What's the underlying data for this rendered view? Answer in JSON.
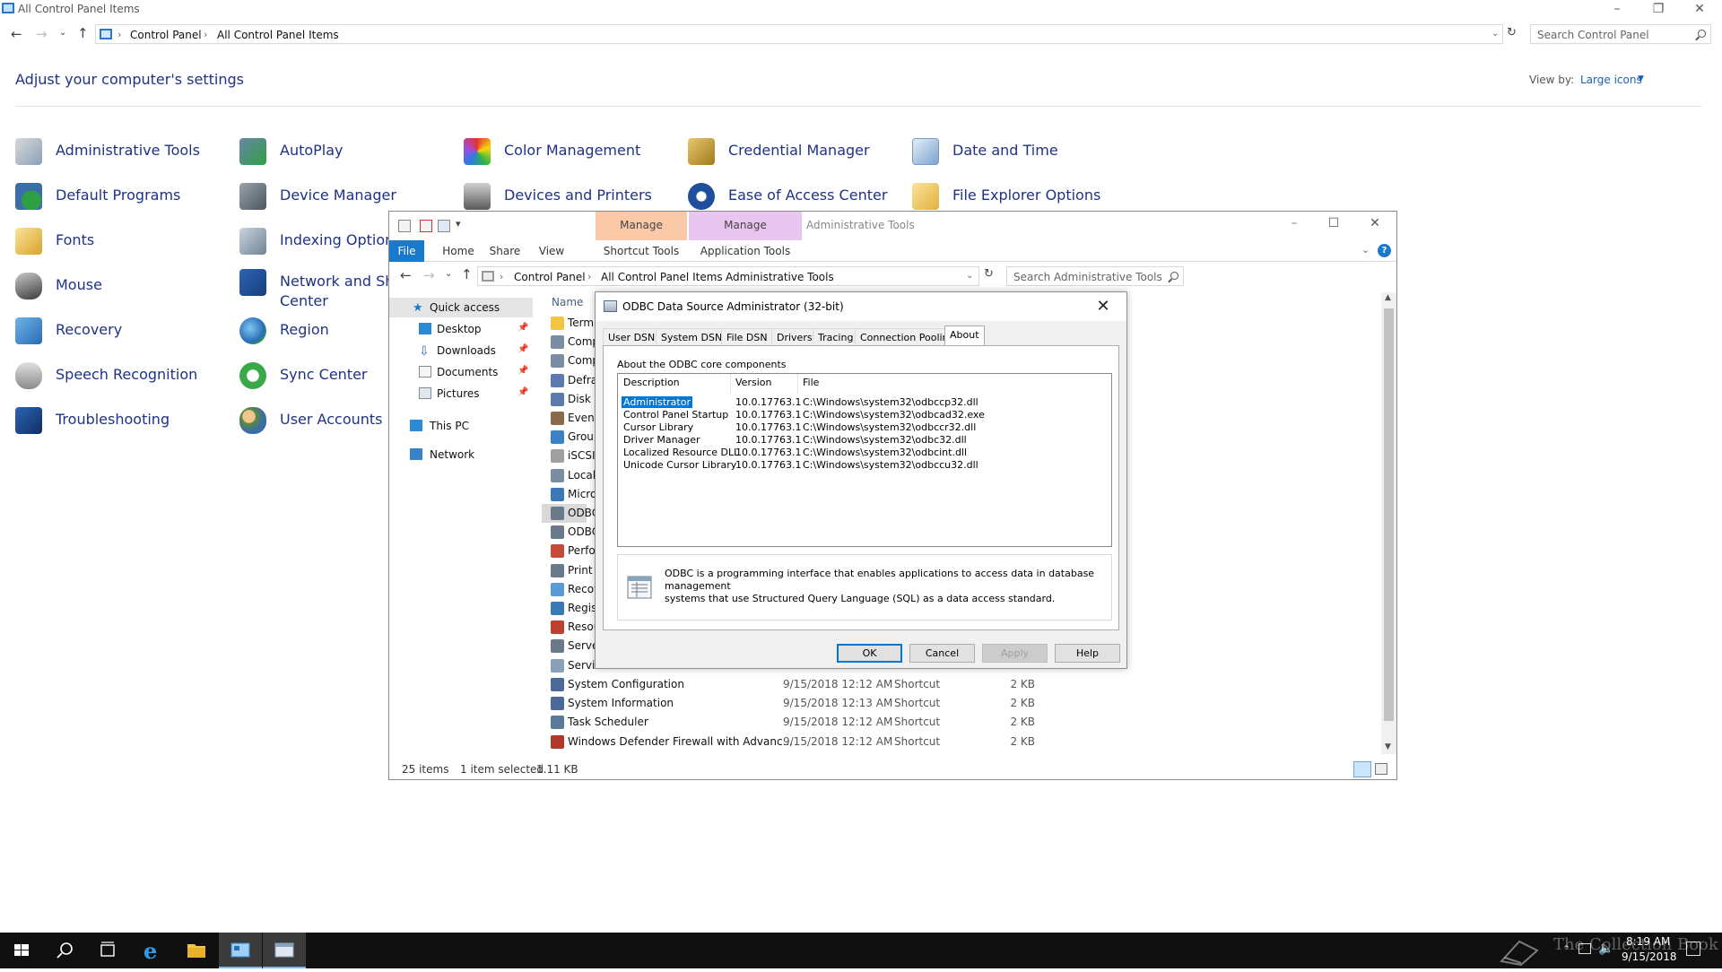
{
  "control_panel": {
    "window_title": "All Control Panel Items",
    "breadcrumb": [
      "Control Panel",
      "All Control Panel Items"
    ],
    "search_placeholder": "Search Control Panel",
    "heading": "Adjust your computer's settings",
    "view_by_label": "View by:",
    "view_by_value": "Large icons",
    "items": [
      {
        "label": "Administrative Tools",
        "icon": "admin-tools-icon"
      },
      {
        "label": "AutoPlay",
        "icon": "autoplay-icon"
      },
      {
        "label": "Color Management",
        "icon": "color-management-icon"
      },
      {
        "label": "Credential Manager",
        "icon": "credential-manager-icon"
      },
      {
        "label": "Date and Time",
        "icon": "date-time-icon"
      },
      {
        "label": "Default Programs",
        "icon": "default-programs-icon"
      },
      {
        "label": "Device Manager",
        "icon": "device-manager-icon"
      },
      {
        "label": "Devices and Printers",
        "icon": "devices-printers-icon"
      },
      {
        "label": "Ease of Access Center",
        "icon": "ease-of-access-icon"
      },
      {
        "label": "File Explorer Options",
        "icon": "file-explorer-options-icon"
      },
      {
        "label": "Fonts",
        "icon": "fonts-icon"
      },
      {
        "label": "Indexing Options",
        "icon": "indexing-options-icon"
      },
      {
        "label": "Mouse",
        "icon": "mouse-icon"
      },
      {
        "label": "Network and Sha",
        "label2": "Center",
        "icon": "network-sharing-icon"
      },
      {
        "label": "Recovery",
        "icon": "recovery-icon"
      },
      {
        "label": "Region",
        "icon": "region-icon"
      },
      {
        "label": "Speech Recognition",
        "icon": "speech-recognition-icon"
      },
      {
        "label": "Sync Center",
        "icon": "sync-center-icon"
      },
      {
        "label": "Troubleshooting",
        "icon": "troubleshooting-icon"
      },
      {
        "label": "User Accounts",
        "icon": "user-accounts-icon"
      }
    ]
  },
  "explorer": {
    "context_tabs": [
      {
        "label": "Manage",
        "sub": "Shortcut Tools",
        "color": "#f9c9a8"
      },
      {
        "label": "Manage",
        "sub": "Application Tools",
        "color": "#e8c6f0"
      }
    ],
    "title": "Administrative Tools",
    "ribbon_tabs": [
      "File",
      "Home",
      "Share",
      "View"
    ],
    "breadcrumb": [
      "Control Panel",
      "All Control Panel Items",
      "Administrative Tools"
    ],
    "search_placeholder": "Search Administrative Tools",
    "nav": {
      "quick_access": "Quick access",
      "pinned": [
        "Desktop",
        "Downloads",
        "Documents",
        "Pictures"
      ],
      "this_pc": "This PC",
      "network": "Network"
    },
    "column_name": "Name",
    "partial_files": [
      "Termi",
      "Comp",
      "Comp",
      "Defra",
      "Disk C",
      "Event",
      "Group",
      "iSCSI I",
      "Local",
      "Micro",
      "ODBC",
      "ODBC",
      "Perfor",
      "Print M",
      "Recov",
      "Regist",
      "Resou",
      "Serve",
      "Services"
    ],
    "files": [
      {
        "name": "System Configuration",
        "date": "9/15/2018 12:12 AM",
        "type": "Shortcut",
        "size": "2 KB"
      },
      {
        "name": "System Information",
        "date": "9/15/2018 12:13 AM",
        "type": "Shortcut",
        "size": "2 KB"
      },
      {
        "name": "Task Scheduler",
        "date": "9/15/2018 12:12 AM",
        "type": "Shortcut",
        "size": "2 KB"
      },
      {
        "name": "Windows Defender Firewall with Advanc...",
        "date": "9/15/2018 12:12 AM",
        "type": "Shortcut",
        "size": "2 KB"
      }
    ],
    "status_items": "25 items",
    "status_selected": "1 item selected",
    "status_size": "1.11 KB"
  },
  "odbc": {
    "title": "ODBC Data Source Administrator (32-bit)",
    "tabs": [
      "User DSN",
      "System DSN",
      "File DSN",
      "Drivers",
      "Tracing",
      "Connection Pooling",
      "About"
    ],
    "active_tab": "About",
    "caption": "About the ODBC core components",
    "columns": [
      "Description",
      "Version",
      "File"
    ],
    "components": [
      {
        "description": "Administrator",
        "version": "10.0.17763.1",
        "file": "C:\\Windows\\system32\\odbccp32.dll"
      },
      {
        "description": "Control Panel Startup",
        "version": "10.0.17763.1",
        "file": "C:\\Windows\\system32\\odbcad32.exe"
      },
      {
        "description": "Cursor Library",
        "version": "10.0.17763.1",
        "file": "C:\\Windows\\system32\\odbccr32.dll"
      },
      {
        "description": "Driver Manager",
        "version": "10.0.17763.1",
        "file": "C:\\Windows\\system32\\odbc32.dll"
      },
      {
        "description": "Localized Resource DLL",
        "version": "10.0.17763.1",
        "file": "C:\\Windows\\system32\\odbcint.dll"
      },
      {
        "description": "Unicode Cursor Library",
        "version": "10.0.17763.1",
        "file": "C:\\Windows\\system32\\odbccu32.dll"
      }
    ],
    "info_line1": "ODBC is a programming interface that enables applications to access data in database management",
    "info_line2": "systems that use Structured Query Language (SQL) as a data access standard.",
    "buttons": {
      "ok": "OK",
      "cancel": "Cancel",
      "apply": "Apply",
      "help": "Help"
    }
  },
  "taskbar": {
    "time": "8:19 AM",
    "date": "9/15/2018",
    "watermark": "The Collection Book"
  },
  "colors": {
    "link_blue": "#1e3287",
    "accent": "#0078d7",
    "file_tab": "#1979ca",
    "taskbar": "#101010"
  }
}
